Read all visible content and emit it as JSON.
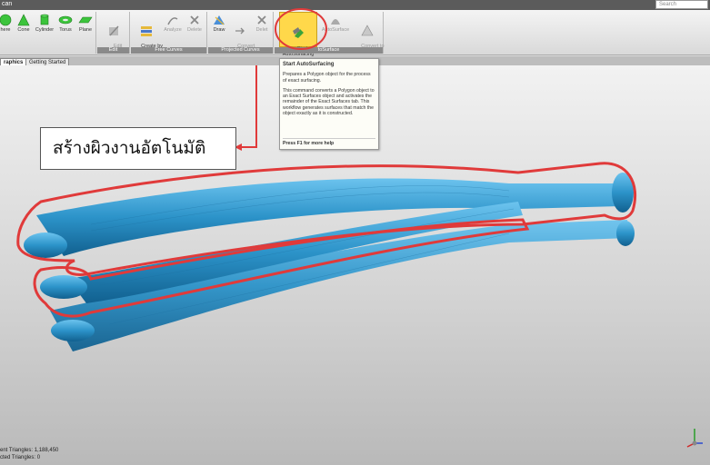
{
  "window": {
    "title": "can",
    "search_placeholder": "Search"
  },
  "ribbon": {
    "primitives": [
      {
        "label": "here",
        "color": "#38c038"
      },
      {
        "label": "Cone",
        "color": "#38c038"
      },
      {
        "label": "Cylinder",
        "color": "#38c038"
      },
      {
        "label": "Torus",
        "color": "#38c038"
      },
      {
        "label": "Plane",
        "color": "#38c038"
      }
    ],
    "edit": {
      "label": "Edit\nFeatures",
      "group": "Edit"
    },
    "free_curves": {
      "create_by_section": "Create by\nSection",
      "analyze": "Analyze",
      "delete": "Delete",
      "group": "Free Curves"
    },
    "projected_curves": {
      "draw": "Draw",
      "convert_to": "Convert\nto",
      "delete": "Delet",
      "group": "Projected Curves"
    },
    "autosurface": {
      "start": "Start\nAutoSurfacing",
      "autosurface": "AutoSurface",
      "convert_to_polygons": "Convert to\nPolygons",
      "group": "toSurface"
    }
  },
  "tabs": [
    "raphics",
    "Getting Started"
  ],
  "tooltip": {
    "title": "Start AutoSurfacing",
    "p1": "Prepares a Polygon object for the process of exact surfacing.",
    "p2": "This command converts a Polygon object to an Exact Surfaces object and activates the remainder of the Exact Surfaces tab. This workflow generates surfaces that match the object exactly as it is constructed.",
    "help": "Press F1 for more help"
  },
  "annotation": {
    "text": "สร้างผิวงานอัตโนมัติ",
    "color": "#e23232"
  },
  "status": {
    "line1": "ent Triangles: 1,188,450",
    "line2": "cted Triangles: 0"
  },
  "colors": {
    "model": "#2c93c9",
    "outline": "#e03a3a"
  }
}
